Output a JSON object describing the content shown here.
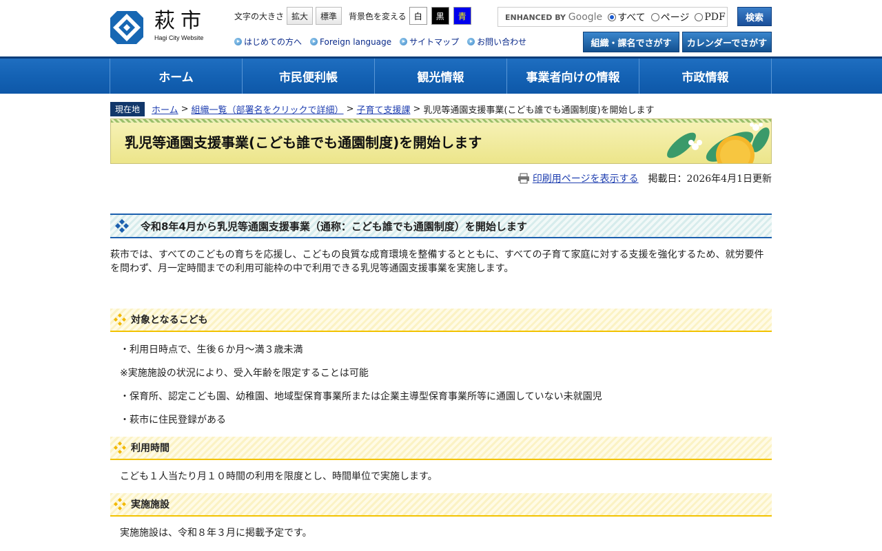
{
  "logo": {
    "jp": "萩市",
    "en": "Hagi City Website"
  },
  "tools": {
    "font_size_label": "文字の大きさ",
    "enlarge": "拡大",
    "standard": "標準",
    "bg_label": "背景色を変える",
    "white": "白",
    "black": "黒",
    "blue": "青"
  },
  "sublinks": [
    "はじめての方へ",
    "Foreign language",
    "サイトマップ",
    "お問い合わせ"
  ],
  "search": {
    "enhanced": "ENHANCED BY",
    "google": "Google",
    "options": [
      "すべて",
      "ページ",
      "PDF"
    ],
    "selected": "すべて",
    "button": "検索"
  },
  "header_buttons": {
    "org": "組織・課名でさがす",
    "calendar": "カレンダーでさがす"
  },
  "gnav": [
    "ホーム",
    "市民便利帳",
    "観光情報",
    "事業者向けの情報",
    "市政情報"
  ],
  "breadcrumb": {
    "here": "現在地",
    "items": [
      "ホーム",
      "組織一覧（部署名をクリックで詳細）",
      "子育て支援課"
    ],
    "current": "乳児等通園支援事業(こども誰でも通園制度)を開始します"
  },
  "page_title": "乳児等通園支援事業(こども誰でも通園制度)を開始します",
  "meta": {
    "print": "印刷用ページを表示する",
    "date": "掲載日：2026年4月1日更新"
  },
  "section": {
    "heading": "令和8年4月から乳児等通園支援事業（通称：こども誰でも通園制度）を開始します",
    "lead": "萩市では、すべてのこどもの育ちを応援し、こどもの良質な成育環境を整備するとともに、すべての子育て家庭に対する支援を強化するため、就労要件を問わず、月一定時間までの利用可能枠の中で利用できる乳児等通園支援事業を実施します。"
  },
  "target": {
    "heading": "対象となるこども",
    "items": [
      "・利用日時点で、生後６か月～満３歳未満",
      "※実施施設の状況により、受入年齢を限定することは可能",
      "・保育所、認定こども園、幼稚園、地域型保育事業所または企業主導型保育事業所等に通園していない未就園児",
      "・萩市に住民登録がある"
    ]
  },
  "usage_time": {
    "heading": "利用時間",
    "text": "こども１人当たり月１０時間の利用を限度とし、時間単位で実施します。"
  },
  "facilities": {
    "heading": "実施施設",
    "text": "実施施設は、令和８年３月に掲載予定です。"
  }
}
